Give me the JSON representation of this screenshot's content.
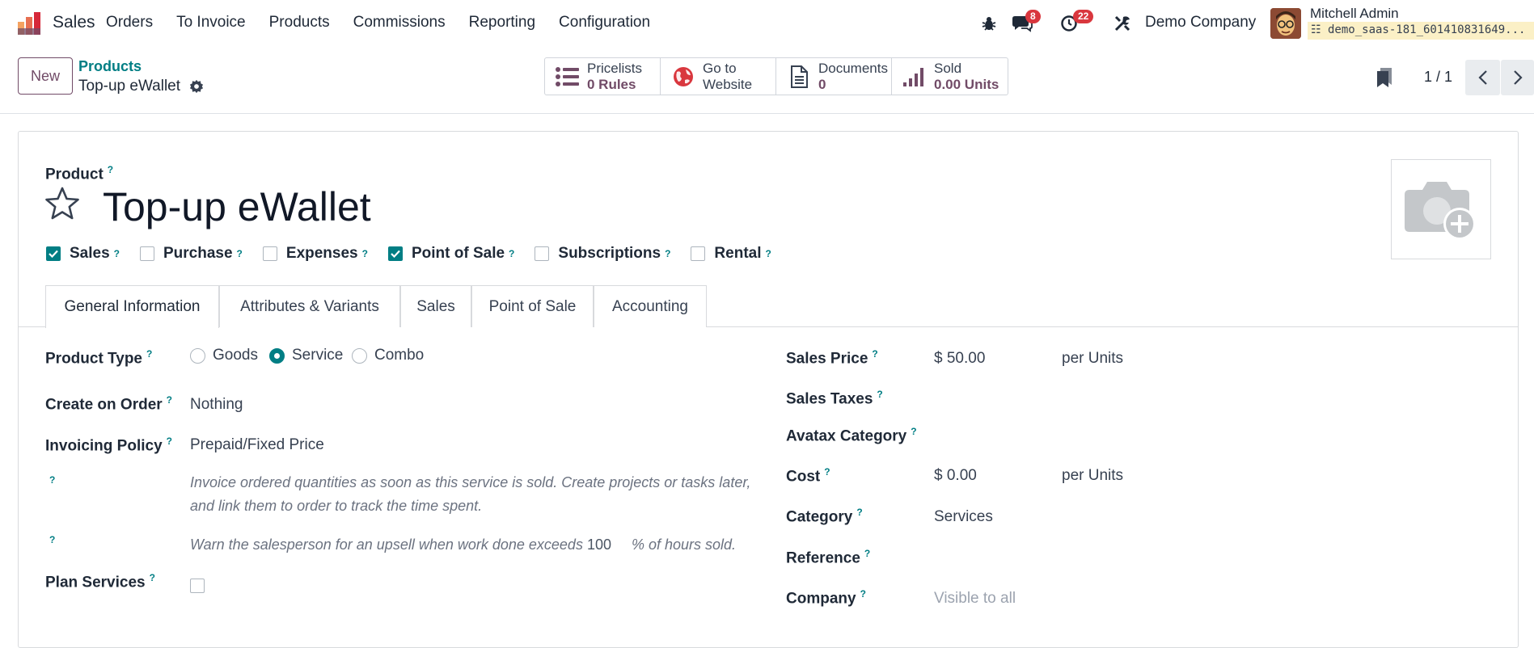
{
  "navbar": {
    "app_name": "Sales",
    "menu": [
      "Orders",
      "To Invoice",
      "Products",
      "Commissions",
      "Reporting",
      "Configuration"
    ],
    "messages_count": "8",
    "activities_count": "22",
    "company": "Demo Company",
    "user_name": "Mitchell Admin",
    "database": "demo_saas-181_601410831649..."
  },
  "control": {
    "new_label": "New",
    "breadcrumb_parent": "Products",
    "breadcrumb_current": "Top-up eWallet",
    "smart_buttons": [
      {
        "label": "Pricelists",
        "value": "0 Rules",
        "icon": "list-icon"
      },
      {
        "label": "Go to",
        "value": "Website",
        "icon": "globe-icon"
      },
      {
        "label": "Documents",
        "value": "0",
        "icon": "document-icon"
      },
      {
        "label": "Sold",
        "value": "0.00 Units",
        "icon": "bar-chart-icon"
      }
    ],
    "pager": "1 / 1"
  },
  "form": {
    "product_label": "Product",
    "help_mark": "?",
    "name": "Top-up eWallet",
    "checkboxes": [
      {
        "label": "Sales",
        "checked": true
      },
      {
        "label": "Purchase",
        "checked": false
      },
      {
        "label": "Expenses",
        "checked": false
      },
      {
        "label": "Point of Sale",
        "checked": true
      },
      {
        "label": "Subscriptions",
        "checked": false
      },
      {
        "label": "Rental",
        "checked": false
      }
    ],
    "tabs": [
      "General Information",
      "Attributes & Variants",
      "Sales",
      "Point of Sale",
      "Accounting"
    ],
    "active_tab": "General Information",
    "left": {
      "product_type_label": "Product Type",
      "product_type_options": [
        "Goods",
        "Service",
        "Combo"
      ],
      "product_type_selected": "Service",
      "create_on_order_label": "Create on Order",
      "create_on_order_value": "Nothing",
      "invoicing_policy_label": "Invoicing Policy",
      "invoicing_policy_value": "Prepaid/Fixed Price",
      "invoicing_note": "Invoice ordered quantities as soon as this service is sold. Create projects or tasks later, and link them to order to track the time spent.",
      "upsell_note_prefix": "Warn the salesperson for an upsell when work done exceeds",
      "upsell_value": "100",
      "upsell_note_suffix": "% of hours sold.",
      "plan_services_label": "Plan Services"
    },
    "right": {
      "sales_price_label": "Sales Price",
      "sales_price_value": "$ 50.00",
      "sales_price_unit": "per Units",
      "sales_taxes_label": "Sales Taxes",
      "avatax_label": "Avatax Category",
      "cost_label": "Cost",
      "cost_value": "$ 0.00",
      "cost_unit": "per Units",
      "category_label": "Category",
      "category_value": "Services",
      "reference_label": "Reference",
      "company_label": "Company",
      "company_placeholder": "Visible to all"
    }
  }
}
